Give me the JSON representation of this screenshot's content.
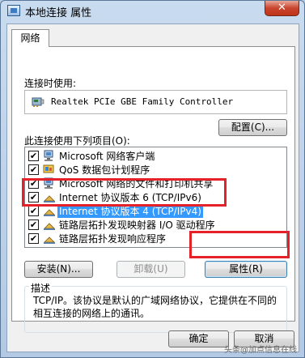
{
  "window": {
    "title": "本地连接 属性",
    "close_glyph": "✕"
  },
  "tabs": [
    {
      "label": "网络"
    }
  ],
  "connect_using": {
    "label": "连接时使用:",
    "adapter": "Realtek PCIe GBE Family Controller",
    "configure_button": "配置(C)..."
  },
  "items_section": {
    "label": "此连接使用下列项目(O):",
    "items": [
      {
        "label": "Microsoft 网络客户端",
        "checked": true,
        "icon": "network-client-icon"
      },
      {
        "label": "QoS 数据包计划程序",
        "checked": true,
        "icon": "qos-icon"
      },
      {
        "label": "Microsoft 网络的文件和打印机共享",
        "checked": true,
        "icon": "file-sharing-icon"
      },
      {
        "label": "Internet 协议版本 6 (TCP/IPv6)",
        "checked": true,
        "icon": "protocol-icon"
      },
      {
        "label": "Internet 协议版本 4 (TCP/IPv4)",
        "checked": true,
        "icon": "protocol-icon"
      },
      {
        "label": "链路层拓扑发现映射器 I/O 驱动程序",
        "checked": true,
        "icon": "protocol-icon"
      },
      {
        "label": "链路层拓扑发现响应程序",
        "checked": true,
        "icon": "protocol-icon"
      }
    ],
    "selected_index": 4
  },
  "item_buttons": {
    "install": "安装(N)...",
    "uninstall": "卸载(U)",
    "properties": "属性(R)"
  },
  "description": {
    "legend": "描述",
    "text": "TCP/IP。该协议是默认的广域网络协议，它提供在不同的相互连接的网络上的通讯。"
  },
  "dialog_buttons": {
    "ok": "确定",
    "cancel": "取消"
  },
  "watermark": "头条@加点信息在线",
  "colors": {
    "selection": "#3399ff",
    "highlight_annotation": "#e5212a"
  }
}
